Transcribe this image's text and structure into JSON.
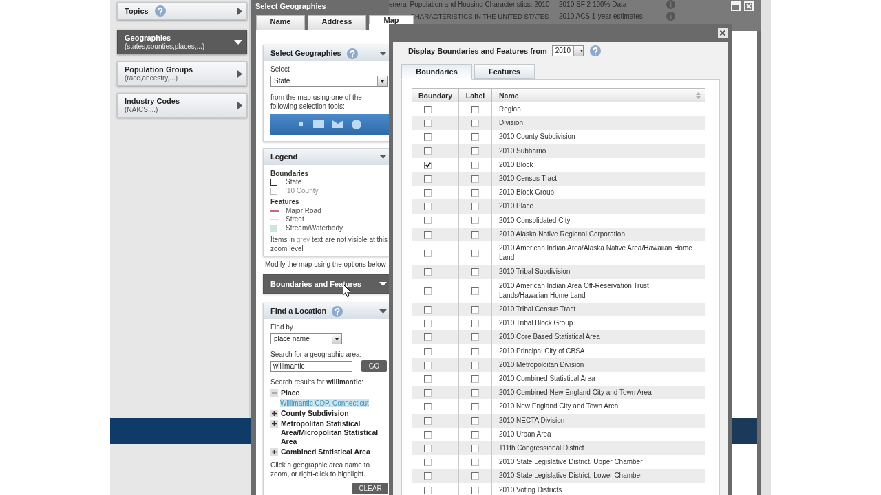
{
  "sidebar": {
    "items": [
      {
        "title": "Topics",
        "help": true,
        "selected": false
      },
      {
        "title": "Geographies",
        "subtitle": "(states,counties,places,...)",
        "help": false,
        "selected": true
      },
      {
        "title": "Population Groups",
        "subtitle": "(race,ancestry,...)",
        "help": false,
        "selected": false
      },
      {
        "title": "Industry Codes",
        "subtitle": "(NAICS,...)",
        "help": false,
        "selected": false
      }
    ]
  },
  "geo_window": {
    "title": "Select Geographies",
    "tabs": [
      {
        "label": "Name",
        "selected": false
      },
      {
        "label": "Address",
        "selected": false
      },
      {
        "label": "Map",
        "selected": true
      }
    ],
    "select_section": {
      "title": "Select Geographies",
      "help": true,
      "selected": false,
      "select_label": "Select",
      "select_value": "State",
      "instructions": "from the map using one of the following selection tools:"
    },
    "legend": {
      "title": "Legend",
      "help": false,
      "selected": false,
      "boundaries_heading": "Boundaries",
      "boundaries": [
        {
          "label": "State",
          "visible": true
        },
        {
          "label": "'10 County",
          "visible": false
        }
      ],
      "features_heading": "Features",
      "features": [
        {
          "kind": "line",
          "label": "Major Road",
          "color": "#c8677c",
          "visible": true
        },
        {
          "kind": "line",
          "label": "Street",
          "color": "#e6d5d5",
          "visible": true
        },
        {
          "kind": "swatch",
          "label": "Stream/Waterbody",
          "color": "#c9e6df",
          "visible": true
        }
      ],
      "note": {
        "before": "Items in ",
        "highlight": "grey",
        "after": " text are not visible at this zoom level"
      }
    },
    "modify_note": "Modify the map using the options below",
    "boundaries_section": {
      "title": "Boundaries and Features",
      "help": false,
      "selected": true
    },
    "find_section": {
      "title": "Find a Location",
      "help": true,
      "selected": false,
      "find_by_label": "Find by",
      "find_by_value": "place name",
      "search_label": "Search for a geographic area:",
      "search_value": "willimantic",
      "go_button": "GO",
      "results_heading": "Search results for **willimantic**:",
      "results": [
        {
          "label": "Place",
          "expanded": true,
          "children": [
            {
              "label": "Willimantic CDP, Connecticut",
              "selected": true
            }
          ]
        },
        {
          "label": "County Subdivision",
          "expanded": false
        },
        {
          "label": "Metropolitan Statistical Area/Micropolitan Statistical Area",
          "expanded": false
        },
        {
          "label": "Combined Statistical Area",
          "expanded": false
        }
      ],
      "hint": "Click a geographic area name to zoom, or right-click to highlight.",
      "clear_button": "CLEAR"
    }
  },
  "background_rows": [
    {
      "description": "eneral Population and Housing Characteristics: 2010",
      "dataset": "2010 SF 2 100% Data"
    },
    {
      "description": "CHARACTERISTICS IN THE UNITED STATES",
      "dataset": "2010 ACS 1-year estimates"
    }
  ],
  "boundaries_dialog": {
    "year_label": "Display Boundaries and Features from",
    "year_value": "2010",
    "help": true,
    "tabs": [
      {
        "label": "Boundaries",
        "selected": true
      },
      {
        "label": "Features",
        "selected": false
      }
    ],
    "table": {
      "columns": [
        {
          "label": "Boundary",
          "sortable": false
        },
        {
          "label": "Label",
          "sortable": false
        },
        {
          "label": "Name",
          "sortable": true
        }
      ],
      "rows": [
        {
          "boundary_checked": false,
          "label_checked": false,
          "name": "Region"
        },
        {
          "boundary_checked": false,
          "label_checked": false,
          "name": "Division"
        },
        {
          "boundary_checked": false,
          "label_checked": false,
          "name": "2010 County Subdivision"
        },
        {
          "boundary_checked": false,
          "label_checked": false,
          "name": "2010 Subbarrio"
        },
        {
          "boundary_checked": true,
          "label_checked": false,
          "name": "2010 Block"
        },
        {
          "boundary_checked": false,
          "label_checked": false,
          "name": "2010 Census Tract"
        },
        {
          "boundary_checked": false,
          "label_checked": false,
          "name": "2010 Block Group"
        },
        {
          "boundary_checked": false,
          "label_checked": false,
          "name": "2010 Place"
        },
        {
          "boundary_checked": false,
          "label_checked": false,
          "name": "2010 Consolidated City"
        },
        {
          "boundary_checked": false,
          "label_checked": false,
          "name": "2010 Alaska Native Regional Corporation"
        },
        {
          "boundary_checked": false,
          "label_checked": false,
          "name": "2010 American Indian Area/Alaska Native Area/Hawaiian Home Land"
        },
        {
          "boundary_checked": false,
          "label_checked": false,
          "name": "2010 Tribal Subdivision"
        },
        {
          "boundary_checked": false,
          "label_checked": false,
          "name": "2010 American Indian Area Off-Reservation Trust Lands/Hawaiian Home Land"
        },
        {
          "boundary_checked": false,
          "label_checked": false,
          "name": "2010 Tribal Census Tract"
        },
        {
          "boundary_checked": false,
          "label_checked": false,
          "name": "2010 Tribal Block Group"
        },
        {
          "boundary_checked": false,
          "label_checked": false,
          "name": "2010 Core Based Statistical Area"
        },
        {
          "boundary_checked": false,
          "label_checked": false,
          "name": "2010 Principal City of CBSA"
        },
        {
          "boundary_checked": false,
          "label_checked": false,
          "name": "2010 Metropoloitan Division"
        },
        {
          "boundary_checked": false,
          "label_checked": false,
          "name": "2010 Combined Statistical Area"
        },
        {
          "boundary_checked": false,
          "label_checked": false,
          "name": "2010 Combined New England City and Town Area"
        },
        {
          "boundary_checked": false,
          "label_checked": false,
          "name": "2010 New England City and Town Area"
        },
        {
          "boundary_checked": false,
          "label_checked": false,
          "name": "2010 NECTA Division"
        },
        {
          "boundary_checked": false,
          "label_checked": false,
          "name": "2010 Urban Area"
        },
        {
          "boundary_checked": false,
          "label_checked": false,
          "name": "111th Congressional District"
        },
        {
          "boundary_checked": false,
          "label_checked": false,
          "name": "2010 State Legislative District, Upper Chamber"
        },
        {
          "boundary_checked": false,
          "label_checked": false,
          "name": "2010 State Legislative District, Lower Chamber"
        },
        {
          "boundary_checked": false,
          "label_checked": false,
          "name": "2010 Voting Districts"
        }
      ]
    }
  }
}
